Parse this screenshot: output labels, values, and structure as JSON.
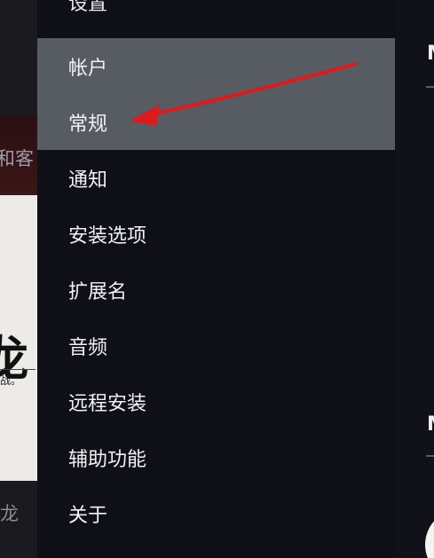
{
  "background": {
    "partial_text_top": "和客",
    "partial_text_bottom": "龙",
    "cover_glyph": "龙",
    "cover_small": "战。"
  },
  "menu": {
    "title_partial": "设置",
    "items": [
      {
        "label": "帐户",
        "active": true
      },
      {
        "label": "常规",
        "active": true
      },
      {
        "label": "通知",
        "active": false
      },
      {
        "label": "安装选项",
        "active": false
      },
      {
        "label": "扩展名",
        "active": false
      },
      {
        "label": "音频",
        "active": false
      },
      {
        "label": "远程安装",
        "active": false
      },
      {
        "label": "辅助功能",
        "active": false
      },
      {
        "label": "关于",
        "active": false
      }
    ],
    "active_color": "#575b62"
  },
  "right_panel": {
    "label_1": "M",
    "label_2": "M"
  },
  "annotation": {
    "type": "arrow",
    "color": "#e01a1a",
    "points_to": "常规"
  }
}
